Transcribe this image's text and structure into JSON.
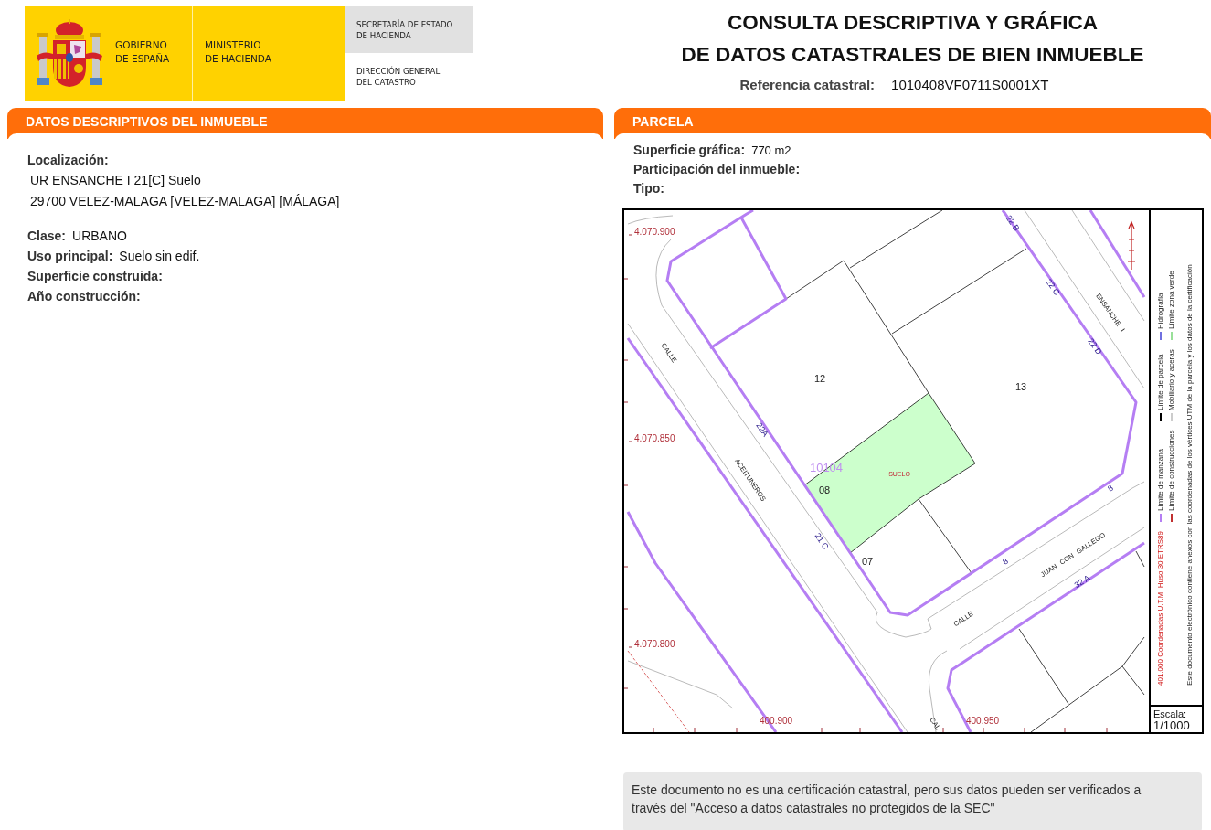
{
  "header": {
    "logo": {
      "government": [
        "GOBIERNO",
        "DE ESPAÑA"
      ],
      "ministry": [
        "MINISTERIO",
        "DE HACIENDA"
      ],
      "secretariat": [
        "SECRETARÍA DE ESTADO",
        "DE HACIENDA"
      ],
      "directorate": [
        "DIRECCIÓN GENERAL",
        "DEL CATASTRO"
      ]
    },
    "title": [
      "CONSULTA DESCRIPTIVA Y GRÁFICA",
      "DE DATOS CATASTRALES DE BIEN INMUEBLE"
    ],
    "reference": {
      "label": "Referencia catastral:",
      "value": "1010408VF0711S0001XT"
    }
  },
  "descriptive_panel": {
    "title": "DATOS DESCRIPTIVOS DEL INMUEBLE",
    "location": {
      "label": "Localización:",
      "lines": [
        "UR ENSANCHE I 21[C] Suelo",
        "29700 VELEZ-MALAGA [VELEZ-MALAGA] [MÁLAGA]"
      ]
    },
    "fields": [
      {
        "label": "Clase:",
        "value": "URBANO"
      },
      {
        "label": "Uso principal:",
        "value": "Suelo sin edif."
      },
      {
        "label": "Superficie construida:"
      },
      {
        "label": "Año construcción:"
      }
    ]
  },
  "parcel_panel": {
    "title": "PARCELA",
    "fields": [
      {
        "label": "Superficie gráfica:",
        "value": "770 m2"
      },
      {
        "label": "Participación del inmueble:"
      },
      {
        "label": "Tipo:"
      }
    ],
    "map": {
      "labels": [
        {
          "text": "4.070.900",
          "kind": "coordinate"
        },
        {
          "text": "22 B",
          "kind": "house_number"
        },
        {
          "text": "22 C",
          "kind": "house_number"
        },
        {
          "text": "ENSANCHE I",
          "kind": "street"
        },
        {
          "text": "CALLE",
          "kind": "street"
        },
        {
          "text": "22 D",
          "kind": "house_number"
        },
        {
          "text": "12",
          "kind": "parcel"
        },
        {
          "text": "13",
          "kind": "parcel"
        },
        {
          "text": "4.070.850",
          "kind": "coordinate"
        },
        {
          "text": "22A",
          "kind": "house_number"
        },
        {
          "text": "ACEITUNEROS",
          "kind": "street"
        },
        {
          "text": "10104",
          "kind": "block"
        },
        {
          "text": "SUELO",
          "kind": "use"
        },
        {
          "text": "08",
          "kind": "parcel"
        },
        {
          "text": "8",
          "kind": "house_number"
        },
        {
          "text": "21 C",
          "kind": "house_number"
        },
        {
          "text": "JUAN CON GALLEGO",
          "kind": "street"
        },
        {
          "text": "07",
          "kind": "parcel"
        },
        {
          "text": "8",
          "kind": "house_number"
        },
        {
          "text": "32 A",
          "kind": "house_number"
        },
        {
          "text": "CALLE",
          "kind": "street"
        },
        {
          "text": "4.070.800",
          "kind": "coordinate"
        },
        {
          "text": "400.900",
          "kind": "coordinate"
        },
        {
          "text": "400.950",
          "kind": "coordinate"
        },
        {
          "text": "CAL",
          "kind": "street"
        }
      ],
      "legend": {
        "coordinates": "401.000 Coordenadas U.T.M. Huso 30 ETRS89",
        "columns": [
          [
            {
              "label": "Límite de manzana",
              "color": "#b57ef3"
            },
            {
              "label": "Límite de parcela",
              "color": "#000000"
            },
            {
              "label": "Hidrografía",
              "color": "#7070e0"
            }
          ],
          [
            {
              "label": "Límite de construcciones",
              "color": "#c03030"
            },
            {
              "label": "Mobiliario y aceras",
              "color": "#cccccc"
            },
            {
              "label": "Límite zona verde",
              "color": "#99e099"
            }
          ]
        ],
        "note": "Este documento electrónico contiene anexos con las coordenadas de los vértices UTM de la parcela y los datos de la certificación"
      },
      "scale": {
        "label": "Escala:",
        "value": "1/1000"
      }
    }
  },
  "notice": "Este documento no es una certificación catastral, pero sus datos pueden ser verificados a través del \"Acceso a datos catastrales no protegidos de la SEC\""
}
